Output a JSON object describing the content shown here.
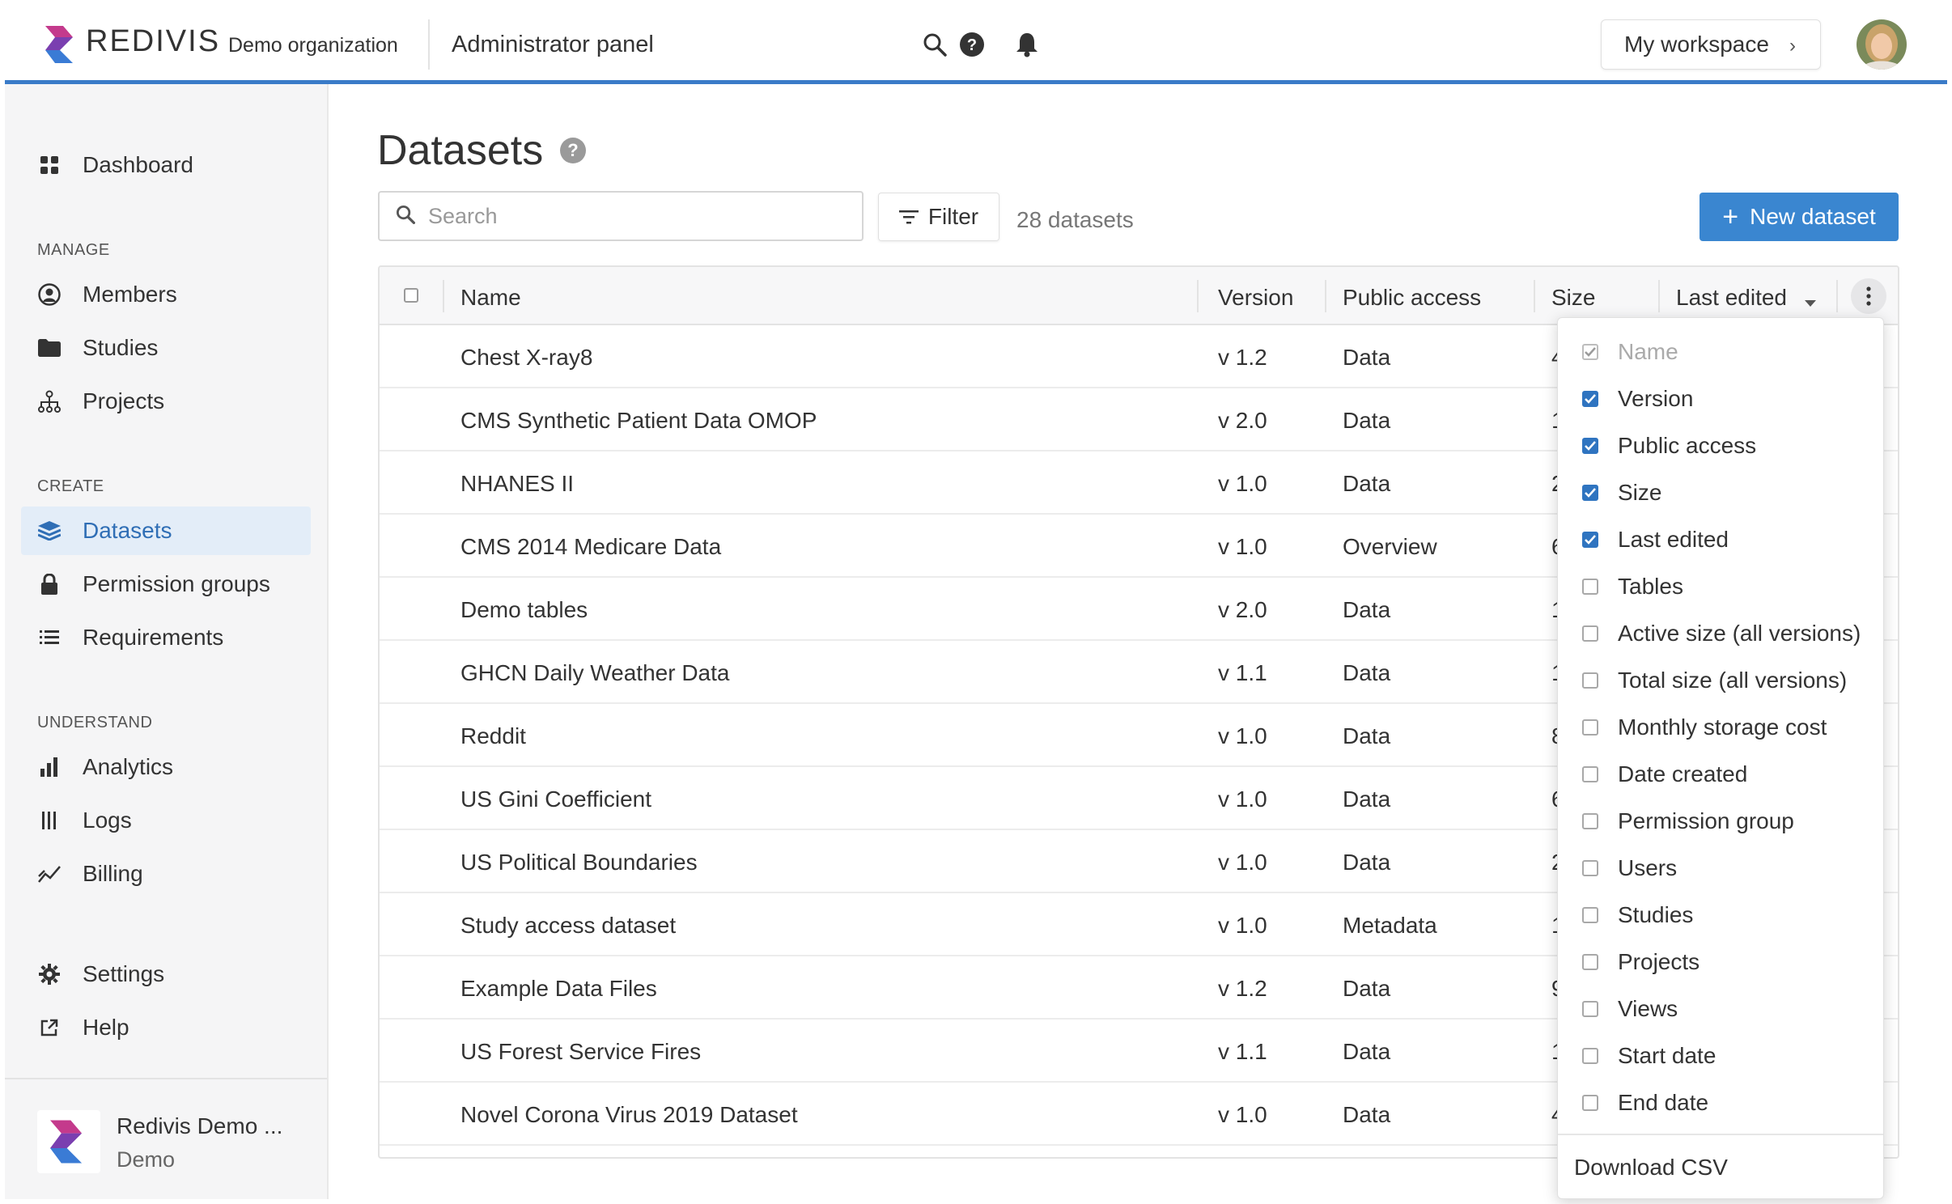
{
  "header": {
    "brand": "REDIVIS",
    "org": "Demo organization",
    "panel": "Administrator panel",
    "workspace_label": "My workspace",
    "icons": [
      "search-icon",
      "help-icon",
      "bell-icon"
    ]
  },
  "sidebar": {
    "dashboard": "Dashboard",
    "section_manage": "MANAGE",
    "members": "Members",
    "studies": "Studies",
    "projects": "Projects",
    "section_create": "CREATE",
    "datasets": "Datasets",
    "permission_groups": "Permission groups",
    "requirements": "Requirements",
    "section_understand": "UNDERSTAND",
    "analytics": "Analytics",
    "logs": "Logs",
    "billing": "Billing",
    "settings": "Settings",
    "help": "Help",
    "footer": {
      "name": "Redivis Demo ...",
      "sub": "Demo"
    }
  },
  "main": {
    "title": "Datasets",
    "help_badge": "?",
    "search_placeholder": "Search",
    "filter_label": "Filter",
    "count_label": "28 datasets",
    "new_button": "New dataset"
  },
  "table": {
    "columns": {
      "name": "Name",
      "version": "Version",
      "public_access": "Public access",
      "size": "Size",
      "last_edited": "Last edited"
    },
    "rows": [
      {
        "name": "Chest X-ray8",
        "version": "v 1.2",
        "access": "Data",
        "size": "4"
      },
      {
        "name": "CMS Synthetic Patient Data OMOP",
        "version": "v 2.0",
        "access": "Data",
        "size": "1"
      },
      {
        "name": "NHANES II",
        "version": "v 1.0",
        "access": "Data",
        "size": "2"
      },
      {
        "name": "CMS 2014 Medicare Data",
        "version": "v 1.0",
        "access": "Overview",
        "size": "6"
      },
      {
        "name": "Demo tables",
        "version": "v 2.0",
        "access": "Data",
        "size": "1"
      },
      {
        "name": "GHCN Daily Weather Data",
        "version": "v 1.1",
        "access": "Data",
        "size": "1"
      },
      {
        "name": "Reddit",
        "version": "v 1.0",
        "access": "Data",
        "size": "8"
      },
      {
        "name": "US Gini Coefficient",
        "version": "v 1.0",
        "access": "Data",
        "size": "6"
      },
      {
        "name": "US Political Boundaries",
        "version": "v 1.0",
        "access": "Data",
        "size": "2"
      },
      {
        "name": "Study access dataset",
        "version": "v 1.0",
        "access": "Metadata",
        "size": "1"
      },
      {
        "name": "Example Data Files",
        "version": "v 1.2",
        "access": "Data",
        "size": "9"
      },
      {
        "name": "US Forest Service Fires",
        "version": "v 1.1",
        "access": "Data",
        "size": "1"
      },
      {
        "name": "Novel Corona Virus 2019 Dataset",
        "version": "v 1.0",
        "access": "Data",
        "size": "4"
      }
    ]
  },
  "dropdown": {
    "items": [
      {
        "label": "Name",
        "checked": true,
        "disabled": true
      },
      {
        "label": "Version",
        "checked": true,
        "disabled": false
      },
      {
        "label": "Public access",
        "checked": true,
        "disabled": false
      },
      {
        "label": "Size",
        "checked": true,
        "disabled": false
      },
      {
        "label": "Last edited",
        "checked": true,
        "disabled": false
      },
      {
        "label": "Tables",
        "checked": false,
        "disabled": false
      },
      {
        "label": "Active size (all versions)",
        "checked": false,
        "disabled": false
      },
      {
        "label": "Total size (all versions)",
        "checked": false,
        "disabled": false
      },
      {
        "label": "Monthly storage cost",
        "checked": false,
        "disabled": false
      },
      {
        "label": "Date created",
        "checked": false,
        "disabled": false
      },
      {
        "label": "Permission group",
        "checked": false,
        "disabled": false
      },
      {
        "label": "Users",
        "checked": false,
        "disabled": false
      },
      {
        "label": "Studies",
        "checked": false,
        "disabled": false
      },
      {
        "label": "Projects",
        "checked": false,
        "disabled": false
      },
      {
        "label": "Views",
        "checked": false,
        "disabled": false
      },
      {
        "label": "Start date",
        "checked": false,
        "disabled": false
      },
      {
        "label": "End date",
        "checked": false,
        "disabled": false
      }
    ],
    "download": "Download CSV"
  },
  "colors": {
    "accent": "#3a86d0",
    "header_rule": "#3a7bc8",
    "active_nav_bg": "#e3edf8",
    "active_nav_text": "#2f6eb5",
    "checkbox_checked": "#2f74c0"
  }
}
